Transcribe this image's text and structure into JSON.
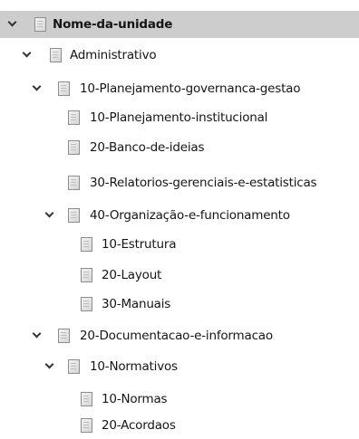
{
  "tree": {
    "root": {
      "label": "Nome-da-unidade",
      "expanded": true,
      "selected": true
    },
    "administrativo": {
      "label": "Administrativo",
      "expanded": true
    },
    "planejamento": {
      "label": "10-Planejamento-governanca-gestao",
      "expanded": true
    },
    "planejamento_institucional": {
      "label": "10-Planejamento-institucional"
    },
    "banco_ideias": {
      "label": "20-Banco-de-ideias"
    },
    "relatorios": {
      "label": "30-Relatorios-gerenciais-e-estatisticas"
    },
    "organizacao": {
      "label": "40-Organização-e-funcionamento",
      "expanded": true
    },
    "estrutura": {
      "label": "10-Estrutura"
    },
    "layout": {
      "label": "20-Layout"
    },
    "manuais": {
      "label": "30-Manuais"
    },
    "documentacao": {
      "label": "20-Documentacao-e-informacao",
      "expanded": true
    },
    "normativos": {
      "label": "10-Normativos",
      "expanded": true
    },
    "normas": {
      "label": "10-Normas"
    },
    "acordaos": {
      "label": "20-Acordaos"
    }
  },
  "icons": {
    "expand": "chevron-down-icon",
    "item": "document-icon"
  },
  "colors": {
    "selection": "#cdcdcd",
    "text": "#151515"
  }
}
